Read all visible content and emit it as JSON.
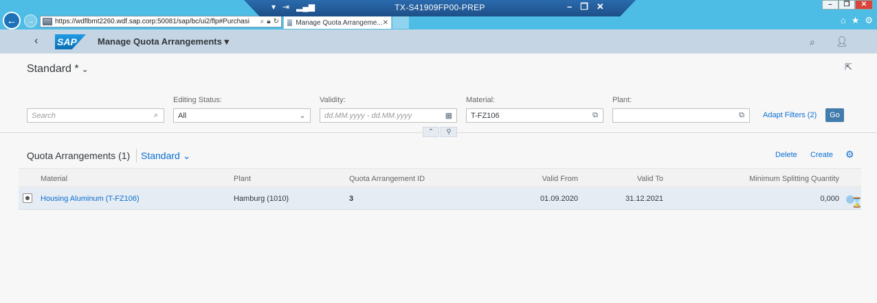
{
  "browser": {
    "url": "https://wdflbmt2260.wdf.sap.corp:50081/sap/bc/ui2/flp#Purchasi",
    "tab_title": "Manage Quota Arrangeme...",
    "tab_close": "✕"
  },
  "remote_desktop": {
    "title": "TX-S41909FP00-PREP"
  },
  "shell": {
    "app_title": "Manage Quota Arrangements ▾",
    "logo_text": "SAP"
  },
  "filter_bar": {
    "variant_name": "Standard *",
    "search_placeholder": "Search",
    "editing_status_label": "Editing Status:",
    "editing_status_value": "All",
    "validity_label": "Validity:",
    "validity_placeholder": "dd.MM.yyyy - dd.MM.yyyy",
    "material_label": "Material:",
    "material_value": "T-FZ106",
    "plant_label": "Plant:",
    "plant_value": "",
    "adapt_filters": "Adapt Filters (2)",
    "go": "Go"
  },
  "table": {
    "title": "Quota Arrangements (1)",
    "variant": "Standard",
    "delete": "Delete",
    "create": "Create",
    "columns": {
      "material": "Material",
      "plant": "Plant",
      "quota_id": "Quota Arrangement ID",
      "valid_from": "Valid From",
      "valid_to": "Valid To",
      "min_split_qty": "Minimum Splitting Quantity"
    },
    "rows": [
      {
        "material": "Housing Aluminum (T-FZ106)",
        "plant": "Hamburg (1010)",
        "quota_id": "3",
        "valid_from": "01.09.2020",
        "valid_to": "31.12.2021",
        "min_split_qty": "0,000"
      }
    ]
  },
  "icons": {
    "back": "back-arrow-icon",
    "search": "search-icon",
    "user": "user-icon",
    "share": "share-icon",
    "calendar": "calendar-icon",
    "value_help": "value-help-icon",
    "settings": "gear-icon"
  }
}
